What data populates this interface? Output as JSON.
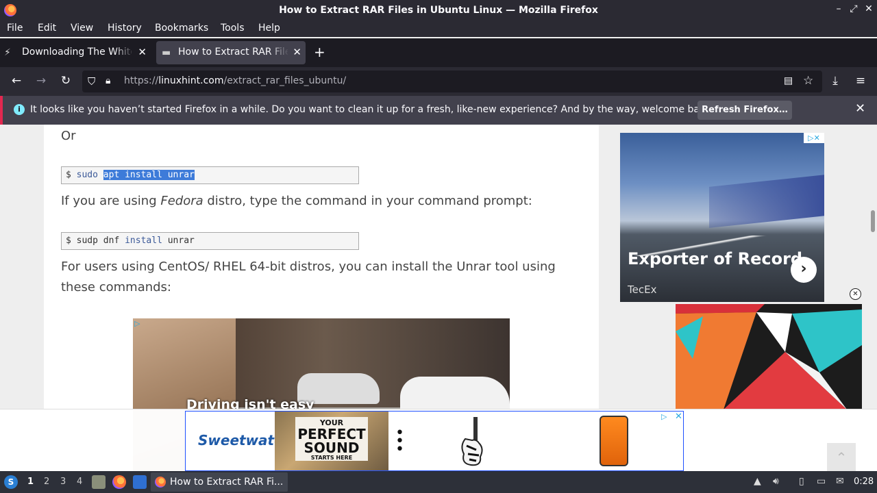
{
  "window": {
    "title": "How to Extract RAR Files in Ubuntu Linux — Mozilla Firefox"
  },
  "menu": [
    "File",
    "Edit",
    "View",
    "History",
    "Bookmarks",
    "Tools",
    "Help"
  ],
  "tabs": [
    {
      "label": "Downloading The White Rabbit",
      "active": false
    },
    {
      "label": "How to Extract RAR Files in Ubuntu Linux",
      "active": true
    }
  ],
  "nav": {
    "url_prefix": "https://",
    "url_domain": "linuxhint.com",
    "url_path": "/extract_rar_files_ubuntu/"
  },
  "notification": {
    "message": "It looks like you haven’t started Firefox in a while. Do you want to clean it up for a fresh, like-new experience? And by the way, welcome back!",
    "button": "Refresh Firefox…"
  },
  "article": {
    "or_text": "Or",
    "code1": {
      "prompt": "$ ",
      "cmd1": "sudo",
      "selected": "apt install unrar"
    },
    "fedora_pre": "If you are using ",
    "fedora_em": "Fedora",
    "fedora_post": " distro, type the command in your command prompt:",
    "code2": {
      "prompt": "$ ",
      "cmd1": "sudp dnf ",
      "kw": "install",
      "rest": " unrar"
    },
    "centos_line1": "For users using CentOS/ RHEL 64-bit distros, you can install the Unrar tool using",
    "centos_line2": "these commands:"
  },
  "ads": {
    "video_caption": "Driving isn't easy",
    "side_title": "Exporter of Record",
    "side_sub": "TecEx",
    "banner_brand": "Sweetwater",
    "banner_t1": "YOUR",
    "banner_t2": "PERFECT SOUND",
    "banner_t3": "STARTS HERE"
  },
  "taskbar": {
    "workspaces": [
      "1",
      "2",
      "3",
      "4"
    ],
    "task_label": "How to Extract RAR Fi...",
    "clock": "0:28"
  }
}
